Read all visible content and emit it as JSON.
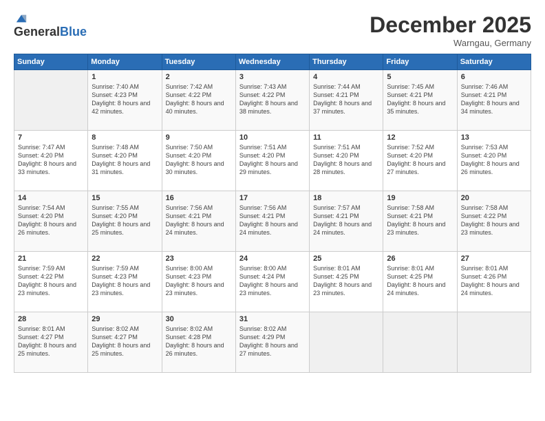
{
  "header": {
    "logo": {
      "general": "General",
      "blue": "Blue"
    },
    "title": "December 2025",
    "location": "Warngau, Germany"
  },
  "weekdays": [
    "Sunday",
    "Monday",
    "Tuesday",
    "Wednesday",
    "Thursday",
    "Friday",
    "Saturday"
  ],
  "weeks": [
    [
      {
        "day": "",
        "empty": true
      },
      {
        "day": "1",
        "sunrise": "7:40 AM",
        "sunset": "4:23 PM",
        "daylight": "8 hours and 42 minutes."
      },
      {
        "day": "2",
        "sunrise": "7:42 AM",
        "sunset": "4:22 PM",
        "daylight": "8 hours and 40 minutes."
      },
      {
        "day": "3",
        "sunrise": "7:43 AM",
        "sunset": "4:22 PM",
        "daylight": "8 hours and 38 minutes."
      },
      {
        "day": "4",
        "sunrise": "7:44 AM",
        "sunset": "4:21 PM",
        "daylight": "8 hours and 37 minutes."
      },
      {
        "day": "5",
        "sunrise": "7:45 AM",
        "sunset": "4:21 PM",
        "daylight": "8 hours and 35 minutes."
      },
      {
        "day": "6",
        "sunrise": "7:46 AM",
        "sunset": "4:21 PM",
        "daylight": "8 hours and 34 minutes."
      }
    ],
    [
      {
        "day": "7",
        "sunrise": "7:47 AM",
        "sunset": "4:20 PM",
        "daylight": "8 hours and 33 minutes."
      },
      {
        "day": "8",
        "sunrise": "7:48 AM",
        "sunset": "4:20 PM",
        "daylight": "8 hours and 31 minutes."
      },
      {
        "day": "9",
        "sunrise": "7:50 AM",
        "sunset": "4:20 PM",
        "daylight": "8 hours and 30 minutes."
      },
      {
        "day": "10",
        "sunrise": "7:51 AM",
        "sunset": "4:20 PM",
        "daylight": "8 hours and 29 minutes."
      },
      {
        "day": "11",
        "sunrise": "7:51 AM",
        "sunset": "4:20 PM",
        "daylight": "8 hours and 28 minutes."
      },
      {
        "day": "12",
        "sunrise": "7:52 AM",
        "sunset": "4:20 PM",
        "daylight": "8 hours and 27 minutes."
      },
      {
        "day": "13",
        "sunrise": "7:53 AM",
        "sunset": "4:20 PM",
        "daylight": "8 hours and 26 minutes."
      }
    ],
    [
      {
        "day": "14",
        "sunrise": "7:54 AM",
        "sunset": "4:20 PM",
        "daylight": "8 hours and 26 minutes."
      },
      {
        "day": "15",
        "sunrise": "7:55 AM",
        "sunset": "4:20 PM",
        "daylight": "8 hours and 25 minutes."
      },
      {
        "day": "16",
        "sunrise": "7:56 AM",
        "sunset": "4:21 PM",
        "daylight": "8 hours and 24 minutes."
      },
      {
        "day": "17",
        "sunrise": "7:56 AM",
        "sunset": "4:21 PM",
        "daylight": "8 hours and 24 minutes."
      },
      {
        "day": "18",
        "sunrise": "7:57 AM",
        "sunset": "4:21 PM",
        "daylight": "8 hours and 24 minutes."
      },
      {
        "day": "19",
        "sunrise": "7:58 AM",
        "sunset": "4:21 PM",
        "daylight": "8 hours and 23 minutes."
      },
      {
        "day": "20",
        "sunrise": "7:58 AM",
        "sunset": "4:22 PM",
        "daylight": "8 hours and 23 minutes."
      }
    ],
    [
      {
        "day": "21",
        "sunrise": "7:59 AM",
        "sunset": "4:22 PM",
        "daylight": "8 hours and 23 minutes."
      },
      {
        "day": "22",
        "sunrise": "7:59 AM",
        "sunset": "4:23 PM",
        "daylight": "8 hours and 23 minutes."
      },
      {
        "day": "23",
        "sunrise": "8:00 AM",
        "sunset": "4:23 PM",
        "daylight": "8 hours and 23 minutes."
      },
      {
        "day": "24",
        "sunrise": "8:00 AM",
        "sunset": "4:24 PM",
        "daylight": "8 hours and 23 minutes."
      },
      {
        "day": "25",
        "sunrise": "8:01 AM",
        "sunset": "4:25 PM",
        "daylight": "8 hours and 23 minutes."
      },
      {
        "day": "26",
        "sunrise": "8:01 AM",
        "sunset": "4:25 PM",
        "daylight": "8 hours and 24 minutes."
      },
      {
        "day": "27",
        "sunrise": "8:01 AM",
        "sunset": "4:26 PM",
        "daylight": "8 hours and 24 minutes."
      }
    ],
    [
      {
        "day": "28",
        "sunrise": "8:01 AM",
        "sunset": "4:27 PM",
        "daylight": "8 hours and 25 minutes."
      },
      {
        "day": "29",
        "sunrise": "8:02 AM",
        "sunset": "4:27 PM",
        "daylight": "8 hours and 25 minutes."
      },
      {
        "day": "30",
        "sunrise": "8:02 AM",
        "sunset": "4:28 PM",
        "daylight": "8 hours and 26 minutes."
      },
      {
        "day": "31",
        "sunrise": "8:02 AM",
        "sunset": "4:29 PM",
        "daylight": "8 hours and 27 minutes."
      },
      {
        "day": "",
        "empty": true
      },
      {
        "day": "",
        "empty": true
      },
      {
        "day": "",
        "empty": true
      }
    ]
  ],
  "labels": {
    "sunrise": "Sunrise:",
    "sunset": "Sunset:",
    "daylight": "Daylight:"
  }
}
